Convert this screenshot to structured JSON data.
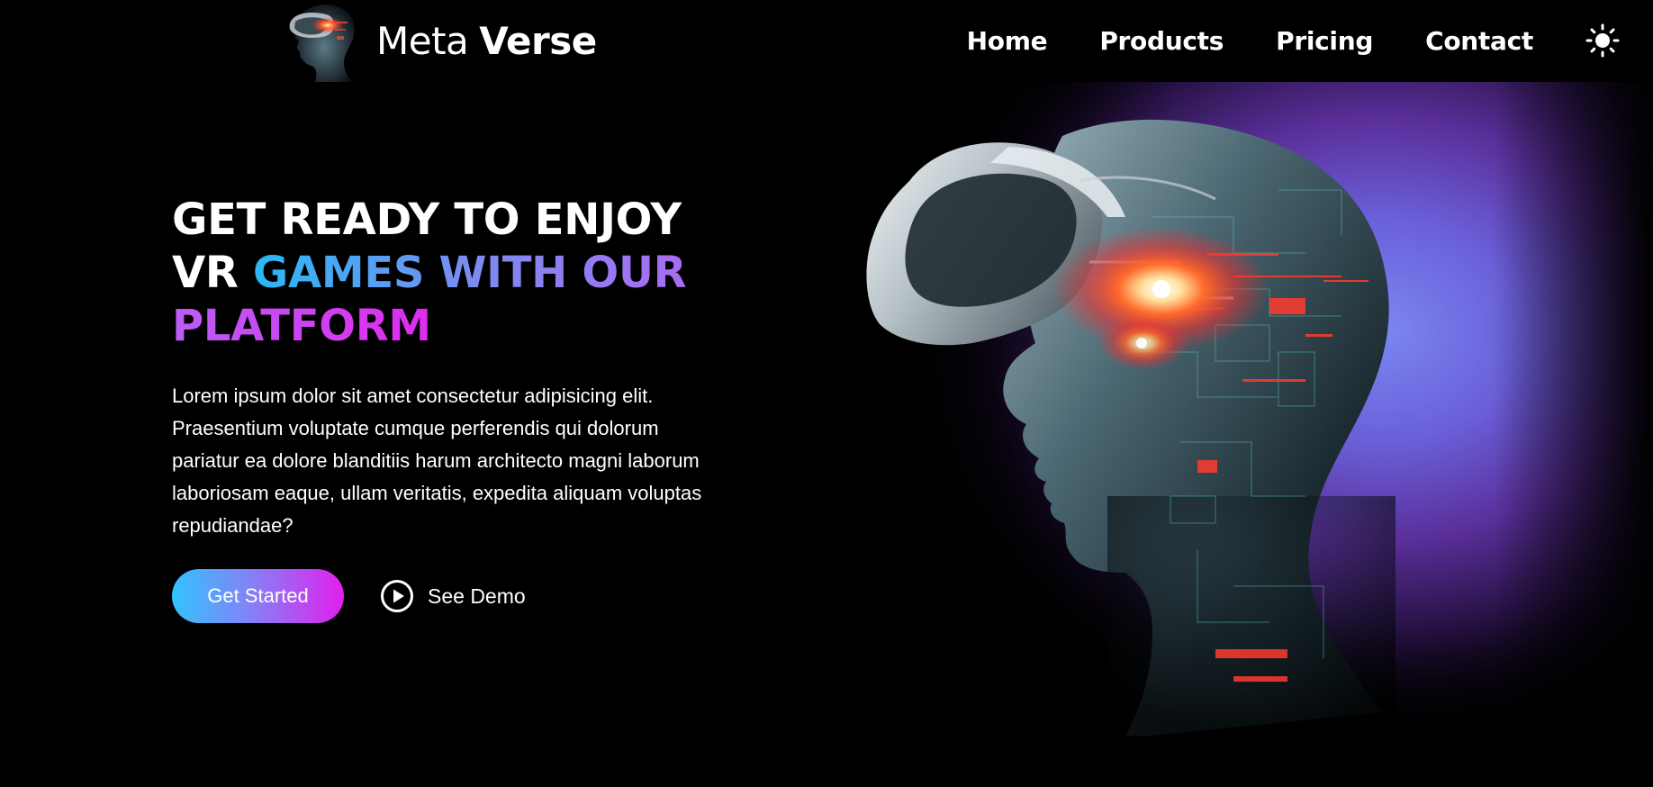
{
  "brand": {
    "name_light": "Meta",
    "name_bold": "Verse",
    "logo_icon": "vr-head-logo-icon"
  },
  "nav": {
    "items": [
      {
        "label": "Home"
      },
      {
        "label": "Products"
      },
      {
        "label": "Pricing"
      },
      {
        "label": "Contact"
      }
    ],
    "theme_toggle_icon": "sun-icon"
  },
  "hero": {
    "title_line1": "GET READY TO ENJOY",
    "title_line2_plain": "VR ",
    "title_line2_gradient": "GAMES WITH OUR",
    "title_line3_gradient": "PLATFORM",
    "description": "Lorem ipsum dolor sit amet consectetur adipisicing elit. Praesentium voluptate cumque perferendis qui dolorum pariatur ea dolore blanditiis harum architecto magni laborum laboriosam eaque, ullam veritatis, expedita aliquam voluptas repudiandae?",
    "cta_primary": "Get Started",
    "cta_secondary": "See Demo",
    "cta_secondary_icon": "play-circle-icon",
    "hero_image_icon": "vr-headset-person-illustration"
  },
  "colors": {
    "background": "#000000",
    "text": "#ffffff",
    "gradient_cyan": "#33c3ff",
    "gradient_violet": "#8b7bf5",
    "gradient_magenta": "#e21fee",
    "glow_blue": "#6f74e6",
    "glow_purple": "#8a3fc8",
    "accent_red": "#ff3b2f"
  }
}
